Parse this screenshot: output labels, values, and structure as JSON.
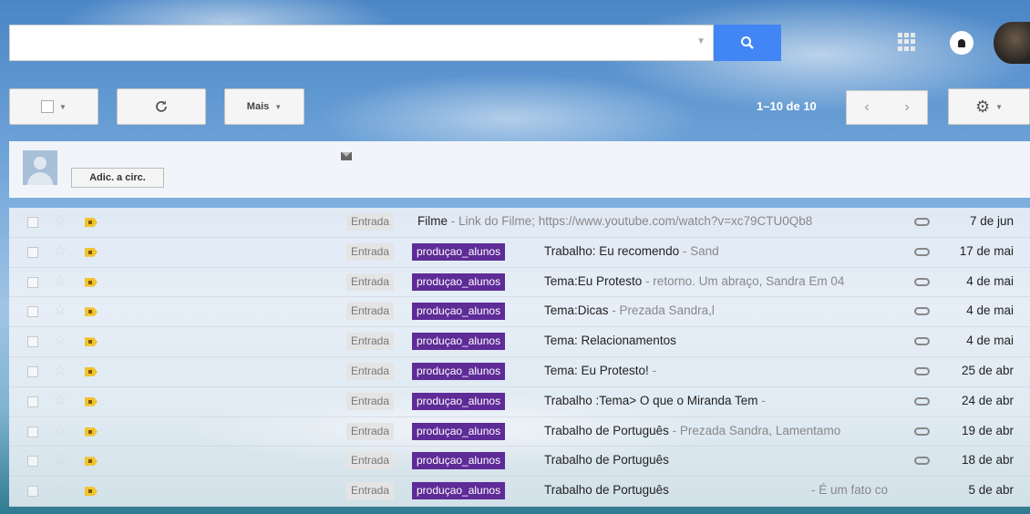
{
  "search": {
    "placeholder": ""
  },
  "toolbar": {
    "more_label": "Mais",
    "pager_text": "1–10 de 10"
  },
  "contact": {
    "add_to_circles_label": "Adic. a circ."
  },
  "emails": [
    {
      "box": "Entrada",
      "tag": "",
      "subject": "Filme",
      "snippet": " - Link do Filme; https://www.youtube.com/watch?v=xc79CTU0Qb8",
      "extra": "",
      "attachment": true,
      "date": "7 de jun"
    },
    {
      "box": "Entrada",
      "tag": "produçao_alunos",
      "subject": "Trabalho: Eu recomendo",
      "snippet": " - Sand",
      "extra": "",
      "attachment": true,
      "date": "17 de mai"
    },
    {
      "box": "Entrada",
      "tag": "produçao_alunos",
      "subject": "Tema:Eu Protesto",
      "snippet": " - retorno. Um abraço, Sandra Em 04",
      "extra": "",
      "attachment": true,
      "date": "4 de mai"
    },
    {
      "box": "Entrada",
      "tag": "produçao_alunos",
      "subject": "Tema:Dicas",
      "snippet": " - Prezada Sandra,l",
      "extra": "",
      "attachment": true,
      "date": "4 de mai"
    },
    {
      "box": "Entrada",
      "tag": "produçao_alunos",
      "subject": "Tema: Relacionamentos",
      "snippet": "",
      "extra": "",
      "attachment": true,
      "date": "4 de mai"
    },
    {
      "box": "Entrada",
      "tag": "produçao_alunos",
      "subject": "Tema: Eu Protesto!",
      "snippet": " -",
      "extra": "",
      "attachment": true,
      "date": "25 de abr"
    },
    {
      "box": "Entrada",
      "tag": "produçao_alunos",
      "subject": "Trabalho :Tema> O que o Miranda Tem",
      "snippet": " -",
      "extra": "",
      "attachment": true,
      "date": "24 de abr"
    },
    {
      "box": "Entrada",
      "tag": "produçao_alunos",
      "subject": "Trabalho de Português",
      "snippet": " - Prezada Sandra, Lamentamo",
      "extra": "",
      "attachment": true,
      "date": "19 de abr"
    },
    {
      "box": "Entrada",
      "tag": "produçao_alunos",
      "subject": "Trabalho de Português",
      "snippet": "",
      "extra": "",
      "attachment": true,
      "date": "18 de abr"
    },
    {
      "box": "Entrada",
      "tag": "produçao_alunos",
      "subject": "Trabalho de Português",
      "snippet": "",
      "extra": "- É um fato co",
      "attachment": false,
      "date": "5 de abr"
    }
  ],
  "colors": {
    "accent": "#4285f4",
    "tag_bg": "#5e2b97",
    "important": "#f2c230"
  }
}
